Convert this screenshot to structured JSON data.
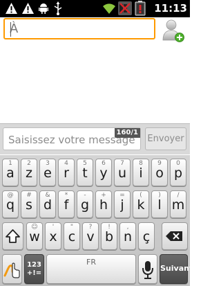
{
  "status_bar": {
    "time": "11:13",
    "icons": [
      "warning-icon",
      "warning-icon",
      "android-icon",
      "usb-icon",
      "wifi-icon",
      "no-signal-icon",
      "battery-icon"
    ]
  },
  "compose": {
    "to_value": "À"
  },
  "message": {
    "placeholder": "Saisissez votre message",
    "counter": "160/1",
    "send_label": "Envoyer"
  },
  "keyboard": {
    "row1": [
      {
        "key": "a",
        "hint": "1"
      },
      {
        "key": "z",
        "hint": "2"
      },
      {
        "key": "e",
        "hint": "3"
      },
      {
        "key": "r",
        "hint": "4"
      },
      {
        "key": "t",
        "hint": "5"
      },
      {
        "key": "y",
        "hint": "6"
      },
      {
        "key": "u",
        "hint": "7"
      },
      {
        "key": "i",
        "hint": "8"
      },
      {
        "key": "o",
        "hint": "9"
      },
      {
        "key": "p",
        "hint": "0"
      }
    ],
    "row2": [
      {
        "key": "q",
        "hint": "@"
      },
      {
        "key": "s",
        "hint": "#"
      },
      {
        "key": "d",
        "hint": "&"
      },
      {
        "key": "f",
        "hint": "*"
      },
      {
        "key": "g",
        "hint": "-"
      },
      {
        "key": "h",
        "hint": "+"
      },
      {
        "key": "j",
        "hint": "="
      },
      {
        "key": "k",
        "hint": "("
      },
      {
        "key": "l",
        "hint": ")"
      },
      {
        "key": "m",
        "hint": "/"
      }
    ],
    "row3": [
      {
        "key": "w",
        "hint": "☺"
      },
      {
        "key": "x",
        "hint": "'"
      },
      {
        "key": "c",
        "hint": "\""
      },
      {
        "key": "v",
        "hint": "?"
      },
      {
        "key": "b",
        "hint": "!"
      },
      {
        "key": "n",
        "hint": ","
      },
      {
        "key": "ç",
        "hint": ""
      }
    ],
    "symbols_label": "123\n+!=",
    "space_label": "FR",
    "action_label": "Suivant"
  }
}
